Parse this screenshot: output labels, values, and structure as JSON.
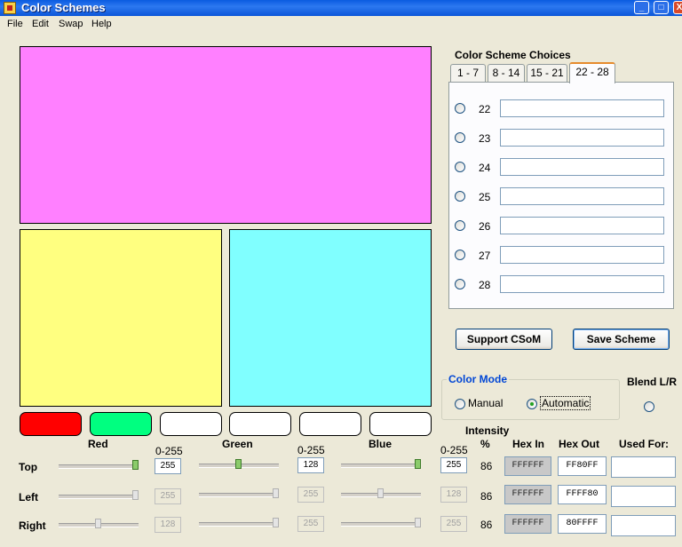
{
  "window": {
    "title": "Color Schemes",
    "min_label": "_",
    "max_label": "□",
    "close_label": "X"
  },
  "menu": [
    "File",
    "Edit",
    "Swap",
    "Help"
  ],
  "colors": {
    "top": "#FF80FF",
    "left": "#FFFF80",
    "right": "#80FFFF",
    "pill_red": "#FF0000",
    "pill_green": "#00FF80"
  },
  "channels": {
    "red_label": "Red",
    "green_label": "Green",
    "blue_label": "Blue",
    "range_label": "0-255"
  },
  "rows": [
    {
      "label": "Top",
      "red": "255",
      "green": "128",
      "blue": "255",
      "intensity": "86",
      "hex_in": "FFFFFF",
      "hex_out": "FF80FF"
    },
    {
      "label": "Left",
      "red": "255",
      "green": "255",
      "blue": "128",
      "intensity": "86",
      "hex_in": "FFFFFF",
      "hex_out": "FFFF80"
    },
    {
      "label": "Right",
      "red": "128",
      "green": "255",
      "blue": "255",
      "intensity": "86",
      "hex_in": "FFFFFF",
      "hex_out": "80FFFF"
    }
  ],
  "columns": {
    "intensity": "Intensity",
    "percent": "%",
    "hex_in": "Hex  In",
    "hex_out": "Hex  Out",
    "used_for": "Used For:"
  },
  "scheme_choices": {
    "title": "Color Scheme Choices",
    "tabs": [
      "1 - 7",
      "8 - 14",
      "15 - 21",
      "22 - 28"
    ],
    "selected_tab": "22 - 28",
    "rows": [
      "22",
      "23",
      "24",
      "25",
      "26",
      "27",
      "28"
    ]
  },
  "buttons": {
    "support": "Support CSoM",
    "save": "Save Scheme"
  },
  "color_mode": {
    "title": "Color Mode",
    "manual": "Manual",
    "automatic": "Automatic",
    "selected": "Automatic"
  },
  "blend": {
    "label": "Blend L/R"
  }
}
